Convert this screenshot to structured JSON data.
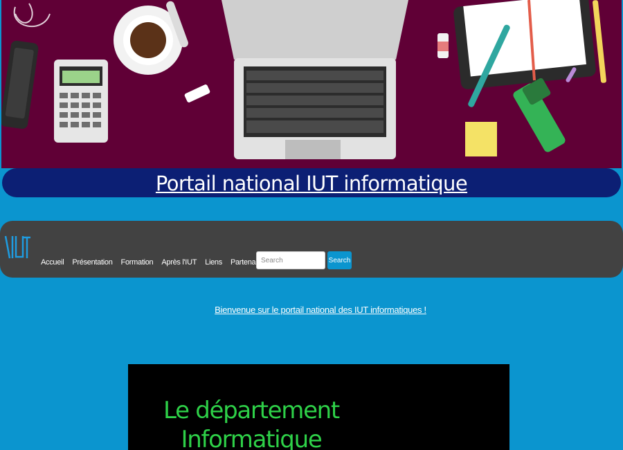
{
  "header": {
    "title": "Portail national IUT informatique"
  },
  "navbar": {
    "logo_text": "\\IUT",
    "links": [
      "Accueil",
      "Présentation",
      "Formation",
      "Après l'IUT",
      "Liens",
      "Partenariats"
    ],
    "search": {
      "placeholder": "Search",
      "button_label": "Search"
    }
  },
  "welcome": {
    "text": "Bienvenue sur le portail national des IUT informatiques !"
  },
  "video": {
    "title_line1": "Le département",
    "title_line2": "Informatique"
  },
  "colors": {
    "page_background": "#0b95cf",
    "banner_background": "#600036",
    "title_bar": "#0c1f74",
    "navbar": "#424242",
    "video_text": "#2ed048"
  },
  "icons": [
    "iut-logo-icon",
    "desk-illustration"
  ]
}
